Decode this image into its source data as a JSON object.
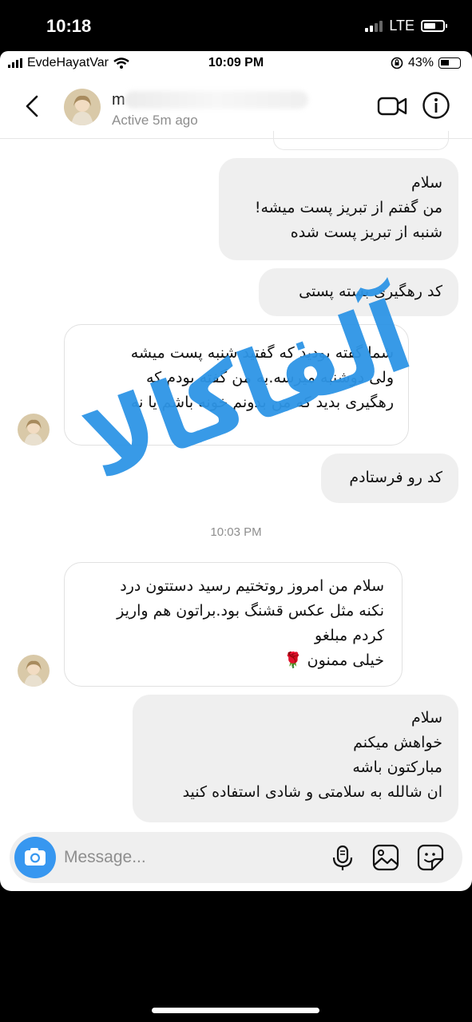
{
  "outer_status": {
    "time": "10:18",
    "network": "LTE"
  },
  "inner_status": {
    "carrier": "EvdeHayatVar",
    "time": "10:09 PM",
    "battery": "43%"
  },
  "header": {
    "name_visible": "m",
    "status": "Active 5m ago"
  },
  "messages": [
    {
      "dir": "out",
      "lines": [
        "سلام",
        "من گفتم از تبریز پست میشه!",
        "شنبه از تبریز پست شده"
      ]
    },
    {
      "dir": "out",
      "lines": [
        "کد رهگیری بسته پستی"
      ]
    },
    {
      "dir": "in",
      "lines": [
        "شما گفته بودید که گفتید شنبه پست میشه",
        "ولی دوشنبه میرسه.به من گفته بودم که",
        "رهگیری بدید که من بدونم خونه باشم یا نه"
      ]
    },
    {
      "dir": "out",
      "lines": [
        "کد رو فرستادم"
      ]
    },
    {
      "dir": "in",
      "lines": [
        "سلام من امروز روتختیم رسید دستتون درد",
        "نکنه مثل عکس قشنگ بود.براتون هم واریز",
        "کردم مبلغو",
        "خیلی ممنون 🌹"
      ]
    },
    {
      "dir": "out",
      "lines": [
        "سلام",
        "خواهش میکنم",
        "مبارکتون باشه",
        "ان شالله به سلامتی و شادی استفاده کنید"
      ]
    }
  ],
  "timestamp": "10:03 PM",
  "composer": {
    "placeholder": "Message..."
  },
  "watermark": "آلفاکالا",
  "colors": {
    "accent": "#3797f0",
    "watermark": "#2e95e6",
    "bubble_out": "#efefef"
  },
  "icons": [
    "back-icon",
    "video-call-icon",
    "info-icon",
    "camera-icon",
    "microphone-icon",
    "gallery-icon",
    "sticker-icon"
  ]
}
